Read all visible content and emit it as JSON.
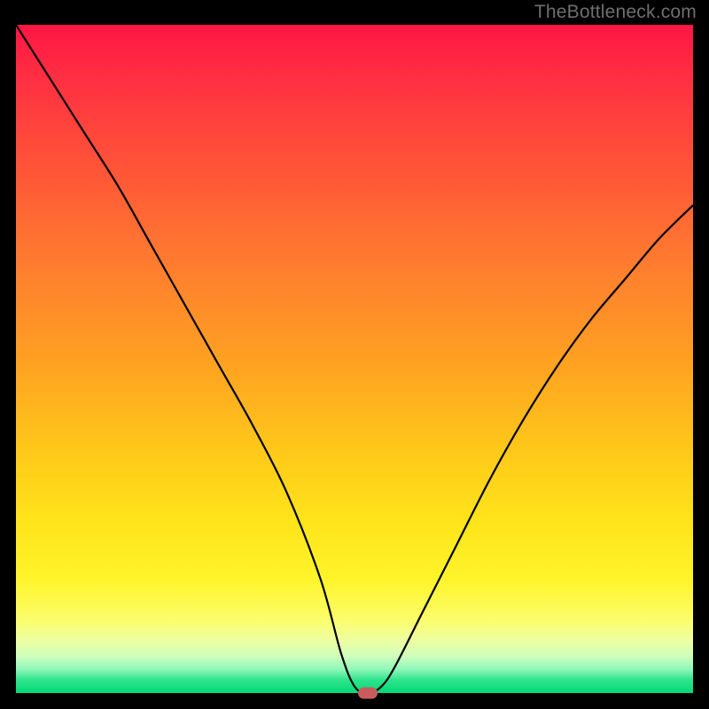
{
  "watermark": "TheBottleneck.com",
  "colors": {
    "black": "#000000",
    "curve": "#000000",
    "marker": "#c95c5c",
    "watermark": "#6f6f6f"
  },
  "chart_data": {
    "type": "line",
    "title": "",
    "xlabel": "",
    "ylabel": "",
    "xlim": [
      0,
      100
    ],
    "ylim": [
      0,
      100
    ],
    "grid": false,
    "legend": null,
    "marker": {
      "x": 52,
      "y": 0
    },
    "series": [
      {
        "name": "bottleneck-curve",
        "x": [
          0,
          5,
          10,
          15,
          20,
          25,
          30,
          35,
          40,
          45,
          48,
          50,
          52,
          54,
          56,
          60,
          65,
          70,
          75,
          80,
          85,
          90,
          95,
          100
        ],
        "values": [
          100,
          92,
          84,
          76,
          67,
          58,
          49,
          40,
          30,
          17,
          6,
          1,
          0,
          1,
          4,
          12,
          22,
          32,
          41,
          49,
          56,
          62,
          68,
          73
        ]
      }
    ],
    "background_gradient_stops": [
      {
        "pos": 0.0,
        "color": "#ff1644"
      },
      {
        "pos": 0.08,
        "color": "#ff2f42"
      },
      {
        "pos": 0.2,
        "color": "#ff5038"
      },
      {
        "pos": 0.35,
        "color": "#ff7a30"
      },
      {
        "pos": 0.5,
        "color": "#ffa022"
      },
      {
        "pos": 0.63,
        "color": "#ffc61a"
      },
      {
        "pos": 0.74,
        "color": "#ffe31a"
      },
      {
        "pos": 0.83,
        "color": "#fff42a"
      },
      {
        "pos": 0.89,
        "color": "#fbfd6a"
      },
      {
        "pos": 0.92,
        "color": "#f0ffa0"
      },
      {
        "pos": 0.945,
        "color": "#cfffbc"
      },
      {
        "pos": 0.965,
        "color": "#8cf7b8"
      },
      {
        "pos": 0.98,
        "color": "#30e48e"
      },
      {
        "pos": 1.0,
        "color": "#02da77"
      }
    ]
  }
}
